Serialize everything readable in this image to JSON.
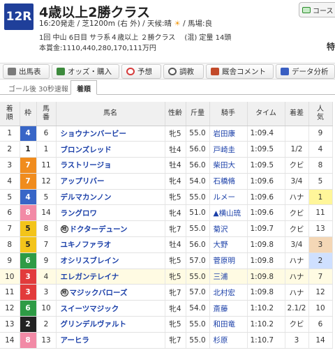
{
  "race": {
    "number": "12R",
    "title": "4歳以上2勝クラス",
    "course_button": "コース",
    "info_line1_a": "16:20発走 / 芝1200m (右 外) / 天候:晴",
    "info_line1_b": "/ 馬場:良",
    "info_line2": "1回 中山 6日目 サラ系４歳以上 ２勝クラス　 (混) 定量 14頭",
    "info_line3": "本賞金:1110,440,280,170,111万円",
    "side_mark": "特"
  },
  "tabs": [
    {
      "label": "出馬表",
      "icon": "table-icon",
      "color": "#7a7a7a"
    },
    {
      "label": "オッズ・購入",
      "icon": "odds-icon",
      "color": "#3c8a3c"
    },
    {
      "label": "予想",
      "icon": "target-icon",
      "color": "#d63b3b"
    },
    {
      "label": "調教",
      "icon": "stopwatch-icon",
      "color": "#555555"
    },
    {
      "label": "厩舎コメント",
      "icon": "comment-icon",
      "color": "#c24a2a"
    },
    {
      "label": "データ分析",
      "icon": "chart-icon",
      "color": "#3a5fc2"
    }
  ],
  "subtabs": [
    {
      "label": "ゴール後 30秒速報",
      "active": false
    },
    {
      "label": "着順",
      "active": true
    }
  ],
  "table": {
    "headers": {
      "rank": [
        "着",
        "順"
      ],
      "frame": "枠",
      "horse_no": [
        "馬",
        "番"
      ],
      "name": "馬名",
      "sex_age": "性齢",
      "weight": "斤量",
      "jockey": "騎手",
      "time": "タイム",
      "margin": "着差",
      "popularity": [
        "人",
        "気"
      ]
    },
    "rows": [
      {
        "rank": "1",
        "frame": "4",
        "no": "6",
        "name": "ショウナンバービー",
        "mark": "",
        "sex_age": "牝5",
        "weight": "55.0",
        "jockey": "岩田康",
        "time": "1:09.4",
        "margin": "",
        "pop": "9"
      },
      {
        "rank": "2",
        "frame": "1",
        "no": "1",
        "name": "ブロンズレッド",
        "mark": "",
        "sex_age": "牡4",
        "weight": "56.0",
        "jockey": "戸崎圭",
        "time": "1:09.5",
        "margin": "1/2",
        "pop": "4"
      },
      {
        "rank": "3",
        "frame": "7",
        "no": "11",
        "name": "ラストリージョ",
        "mark": "",
        "sex_age": "牡4",
        "weight": "56.0",
        "jockey": "柴田大",
        "time": "1:09.5",
        "margin": "クビ",
        "pop": "8"
      },
      {
        "rank": "4",
        "frame": "7",
        "no": "12",
        "name": "アップリバー",
        "mark": "",
        "sex_age": "牝4",
        "weight": "54.0",
        "jockey": "石橋脩",
        "time": "1:09.6",
        "margin": "3/4",
        "pop": "5"
      },
      {
        "rank": "5",
        "frame": "4",
        "no": "5",
        "name": "デルマカンノン",
        "mark": "",
        "sex_age": "牝5",
        "weight": "55.0",
        "jockey": "ルメー",
        "time": "1:09.6",
        "margin": "ハナ",
        "pop": "1"
      },
      {
        "rank": "6",
        "frame": "8",
        "no": "14",
        "name": "ラングロワ",
        "mark": "",
        "sex_age": "牝4",
        "weight": "51.0",
        "jockey": "▲横山琉",
        "time": "1:09.6",
        "margin": "クビ",
        "pop": "11"
      },
      {
        "rank": "7",
        "frame": "5",
        "no": "8",
        "name": "ドクターデューン",
        "mark": "地",
        "sex_age": "牝7",
        "weight": "55.0",
        "jockey": "菊沢",
        "time": "1:09.7",
        "margin": "クビ",
        "pop": "13"
      },
      {
        "rank": "8",
        "frame": "5",
        "no": "7",
        "name": "ユキノファラオ",
        "mark": "",
        "sex_age": "牡4",
        "weight": "56.0",
        "jockey": "大野",
        "time": "1:09.8",
        "margin": "3/4",
        "pop": "3"
      },
      {
        "rank": "9",
        "frame": "6",
        "no": "9",
        "name": "オシリスブレイン",
        "mark": "",
        "sex_age": "牝5",
        "weight": "57.0",
        "jockey": "菅原明",
        "time": "1:09.8",
        "margin": "ハナ",
        "pop": "2"
      },
      {
        "rank": "10",
        "frame": "3",
        "no": "4",
        "name": "エレガンテレイナ",
        "mark": "",
        "sex_age": "牝5",
        "weight": "55.0",
        "jockey": "三浦",
        "time": "1:09.8",
        "margin": "ハナ",
        "pop": "7"
      },
      {
        "rank": "11",
        "frame": "3",
        "no": "3",
        "name": "マジックバローズ",
        "mark": "地",
        "sex_age": "牝7",
        "weight": "57.0",
        "jockey": "北村宏",
        "time": "1:09.8",
        "margin": "ハナ",
        "pop": "12"
      },
      {
        "rank": "12",
        "frame": "6",
        "no": "10",
        "name": "スイーツマジック",
        "mark": "",
        "sex_age": "牝4",
        "weight": "54.0",
        "jockey": "斎藤",
        "time": "1:10.2",
        "margin": "2.1/2",
        "pop": "10"
      },
      {
        "rank": "13",
        "frame": "2",
        "no": "2",
        "name": "グリンデルヴァルト",
        "mark": "",
        "sex_age": "牝5",
        "weight": "55.0",
        "jockey": "和田竜",
        "time": "1:10.2",
        "margin": "クビ",
        "pop": "6"
      },
      {
        "rank": "14",
        "frame": "8",
        "no": "13",
        "name": "アーヒラ",
        "mark": "",
        "sex_age": "牝7",
        "weight": "55.0",
        "jockey": "杉原",
        "time": "1:10.7",
        "margin": "3",
        "pop": "14"
      }
    ],
    "highlight_rank": "10"
  },
  "frame_colors": {
    "1": {
      "bg": "#ffffff",
      "fg": "#222222"
    },
    "2": {
      "bg": "#222222",
      "fg": "#ffffff"
    },
    "3": {
      "bg": "#e23b3b",
      "fg": "#ffffff"
    },
    "4": {
      "bg": "#3866c7",
      "fg": "#ffffff"
    },
    "5": {
      "bg": "#f3c41a",
      "fg": "#222222"
    },
    "6": {
      "bg": "#2e9b45",
      "fg": "#ffffff"
    },
    "7": {
      "bg": "#f08c1e",
      "fg": "#ffffff"
    },
    "8": {
      "bg": "#f28aa6",
      "fg": "#ffffff"
    }
  },
  "popularity_colors": {
    "1": "#fff69a",
    "2": "#cfe0ff",
    "3": "#f4d7b6"
  }
}
